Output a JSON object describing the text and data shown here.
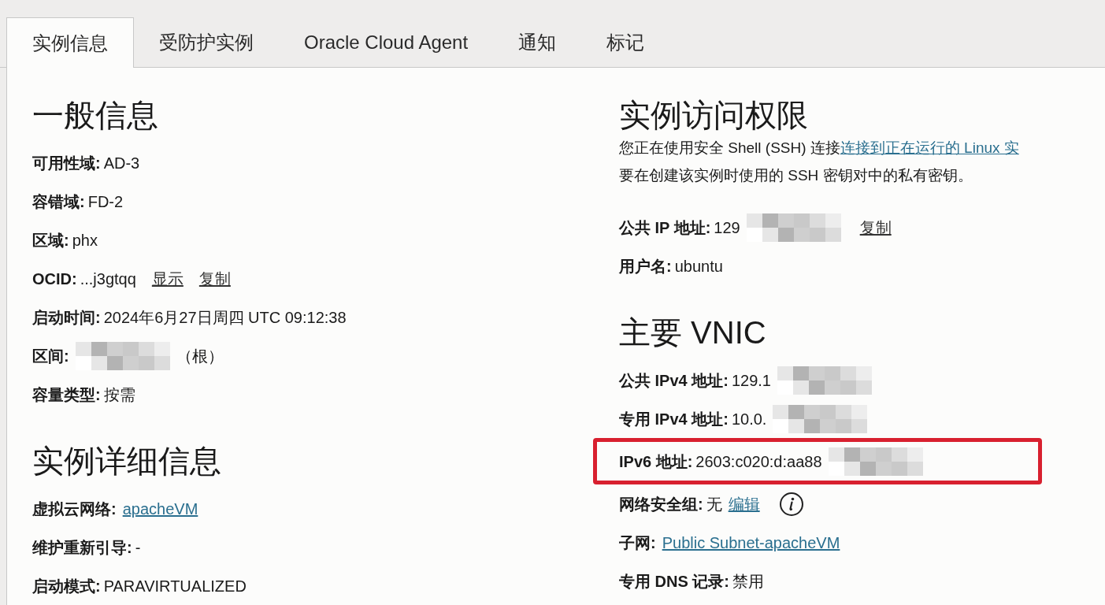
{
  "tabs": [
    {
      "label": "实例信息",
      "selected": true
    },
    {
      "label": "受防护实例",
      "selected": false
    },
    {
      "label": "Oracle Cloud Agent",
      "selected": false
    },
    {
      "label": "通知",
      "selected": false
    },
    {
      "label": "标记",
      "selected": false
    }
  ],
  "left": [
    {
      "title": "一般信息",
      "rows": [
        {
          "label": "可用性域:",
          "parts": [
            {
              "kind": "text",
              "text": "AD-3"
            }
          ]
        },
        {
          "label": "容错域:",
          "parts": [
            {
              "kind": "text",
              "text": "FD-2"
            }
          ]
        },
        {
          "label": "区域:",
          "parts": [
            {
              "kind": "text",
              "text": "phx"
            }
          ]
        },
        {
          "label": "OCID:",
          "parts": [
            {
              "kind": "text",
              "text": "...j3gtqq"
            },
            {
              "kind": "action",
              "text": "显示"
            },
            {
              "kind": "action",
              "text": "复制"
            }
          ]
        },
        {
          "label": "启动时间:",
          "parts": [
            {
              "kind": "text",
              "text": "2024年6月27日周四 UTC 09:12:38"
            }
          ]
        },
        {
          "label": "区间:",
          "parts": [
            {
              "kind": "redacted"
            },
            {
              "kind": "text",
              "text": "（根）"
            }
          ]
        },
        {
          "label": "容量类型:",
          "parts": [
            {
              "kind": "text",
              "text": "按需"
            }
          ]
        }
      ]
    },
    {
      "title": "实例详细信息",
      "rows": [
        {
          "label": "虚拟云网络:",
          "parts": [
            {
              "kind": "link",
              "text": "apacheVM"
            }
          ]
        },
        {
          "label": "维护重新引导:",
          "parts": [
            {
              "kind": "text",
              "text": "-"
            }
          ]
        },
        {
          "label": "启动模式:",
          "parts": [
            {
              "kind": "text",
              "text": "PARAVIRTUALIZED"
            }
          ]
        }
      ]
    }
  ],
  "right": [
    {
      "title": "实例访问权限",
      "intro": {
        "text": "您正在使用安全 Shell (SSH) 连接",
        "link": "连接到正在运行的 Linux 实",
        "after": "要在创建该实例时使用的 SSH 密钥对中的私有密钥。"
      },
      "rows": [
        {
          "label": "公共 IP 地址:",
          "parts": [
            {
              "kind": "text",
              "text": "129"
            },
            {
              "kind": "redacted"
            },
            {
              "kind": "action",
              "text": "复制"
            }
          ]
        },
        {
          "label": "用户名:",
          "parts": [
            {
              "kind": "text",
              "text": "ubuntu"
            }
          ]
        }
      ]
    },
    {
      "title": "主要 VNIC",
      "rows": [
        {
          "label": "公共 IPv4 地址:",
          "parts": [
            {
              "kind": "text",
              "text": "129.1"
            },
            {
              "kind": "redacted"
            }
          ]
        },
        {
          "label": "专用 IPv4 地址:",
          "parts": [
            {
              "kind": "text",
              "text": "10.0."
            },
            {
              "kind": "redacted"
            }
          ]
        },
        {
          "label": "IPv6 地址:",
          "highlighted": true,
          "parts": [
            {
              "kind": "text",
              "text": "2603:c020:d:aa88"
            },
            {
              "kind": "redacted"
            }
          ]
        },
        {
          "label": "网络安全组:",
          "parts": [
            {
              "kind": "text",
              "text": "无"
            },
            {
              "kind": "link",
              "text": "编辑"
            },
            {
              "kind": "info"
            }
          ]
        },
        {
          "label": "子网:",
          "parts": [
            {
              "kind": "link",
              "text": "Public Subnet-apacheVM"
            }
          ]
        },
        {
          "label": "专用 DNS 记录:",
          "parts": [
            {
              "kind": "text",
              "text": "禁用"
            }
          ]
        }
      ]
    }
  ]
}
